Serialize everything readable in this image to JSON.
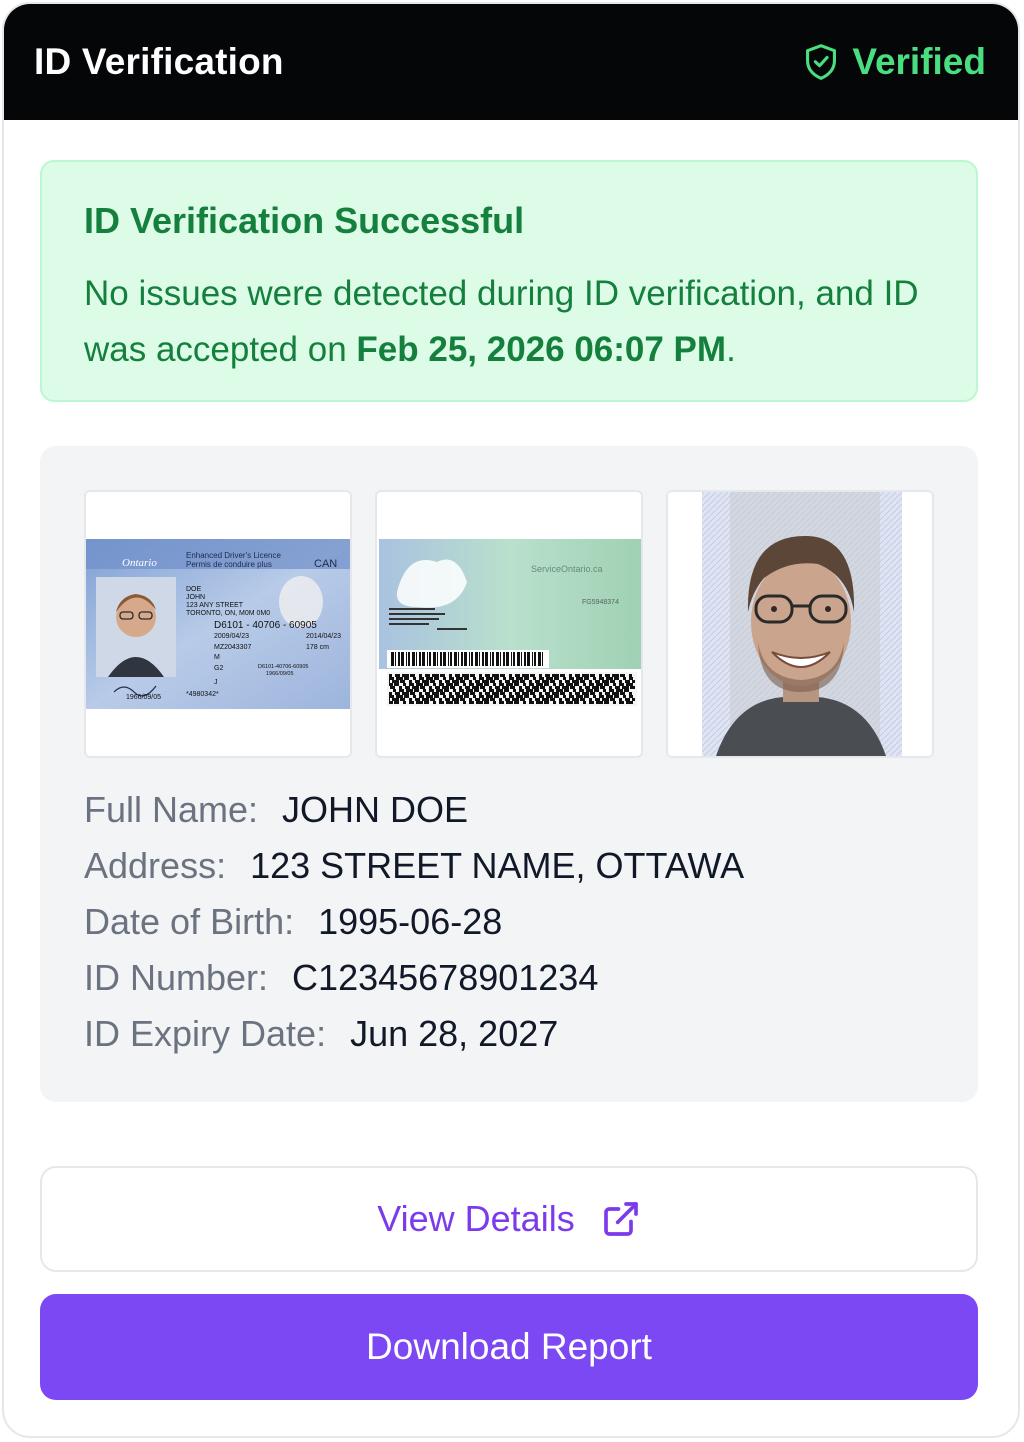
{
  "header": {
    "title": "ID Verification",
    "status": "Verified"
  },
  "success": {
    "title": "ID Verification Successful",
    "text_before": "No issues were detected during ID verification, and ID was accepted on ",
    "date": "Feb 25, 2026 06:07 PM",
    "text_after": "."
  },
  "images": {
    "front": {
      "province": "Ontario",
      "title_en": "Enhanced Driver's Licence",
      "title_fr": "Permis de conduire plus",
      "country": "CAN",
      "surname": "DOE",
      "given": "JOHN",
      "address1": "123 ANY STREET",
      "address2": "TORONTO, ON, M0M 0M0",
      "number": "D6101 - 40706 - 60905",
      "issued": "2009/04/23",
      "expiry": "2014/04/23",
      "dd": "MZ2043307",
      "height": "178 cm",
      "sex": "M",
      "class": "G2",
      "rest": "J",
      "dob": "1966/09/05",
      "serial": "*4980342*",
      "ref1": "D6101-40706-60905",
      "ref2": "1966/09/05"
    },
    "back": {
      "brand": "ServiceOntario.ca",
      "code": "FG5948374"
    }
  },
  "fields": [
    {
      "label": "Full Name:",
      "value": "JOHN DOE"
    },
    {
      "label": "Address:",
      "value": "123 STREET NAME, OTTAWA"
    },
    {
      "label": "Date of Birth:",
      "value": "1995-06-28"
    },
    {
      "label": "ID Number:",
      "value": "C12345678901234"
    },
    {
      "label": "ID Expiry Date:",
      "value": "Jun 28, 2027"
    }
  ],
  "actions": {
    "view_details": "View Details",
    "download_report": "Download Report"
  },
  "colors": {
    "header_bg": "#050608",
    "verified": "#4ade80",
    "success_bg": "#dcfce7",
    "success_text": "#15803d",
    "accent": "#7c48f3"
  },
  "icons": {
    "verified": "shield-check-icon",
    "view_details": "external-link-icon"
  }
}
